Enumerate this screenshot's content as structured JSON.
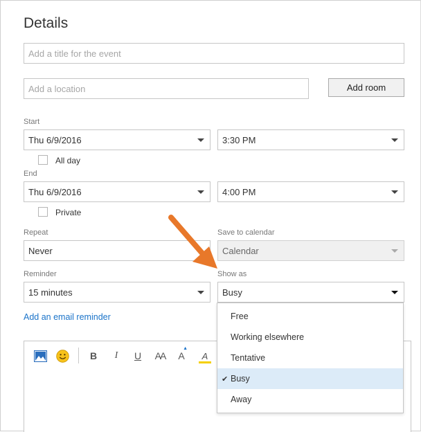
{
  "heading": "Details",
  "title_field": {
    "placeholder": "Add a title for the event",
    "value": ""
  },
  "location_field": {
    "placeholder": "Add a location",
    "value": ""
  },
  "add_room_label": "Add room",
  "start": {
    "label": "Start",
    "date": "Thu 6/9/2016",
    "time": "3:30 PM"
  },
  "all_day": {
    "label": "All day",
    "checked": false
  },
  "end": {
    "label": "End",
    "date": "Thu 6/9/2016",
    "time": "4:00 PM"
  },
  "private": {
    "label": "Private",
    "checked": false
  },
  "repeat": {
    "label": "Repeat",
    "value": "Never"
  },
  "save_to_calendar": {
    "label": "Save to calendar",
    "value": "Calendar",
    "disabled": true
  },
  "reminder": {
    "label": "Reminder",
    "value": "15 minutes"
  },
  "show_as": {
    "label": "Show as",
    "value": "Busy",
    "options": [
      "Free",
      "Working elsewhere",
      "Tentative",
      "Busy",
      "Away"
    ],
    "selected_index": 3
  },
  "email_reminder_link": "Add an email reminder",
  "toolbar": {
    "image_icon": "picture-icon",
    "emoji_icon": "smiley-icon",
    "bold_label": "B",
    "italic_label": "I",
    "underline_label": "U",
    "font_size_label": "AA",
    "font_color_label": "A",
    "highlight_label": "A"
  },
  "colors": {
    "link": "#1a73c9",
    "selected_option_bg": "#dcebf8",
    "annotation_arrow": "#e8782a",
    "highlight_yellow": "#f5d000",
    "emoji_yellow": "#f7c21b",
    "picture_blue": "#2a6ebd"
  }
}
